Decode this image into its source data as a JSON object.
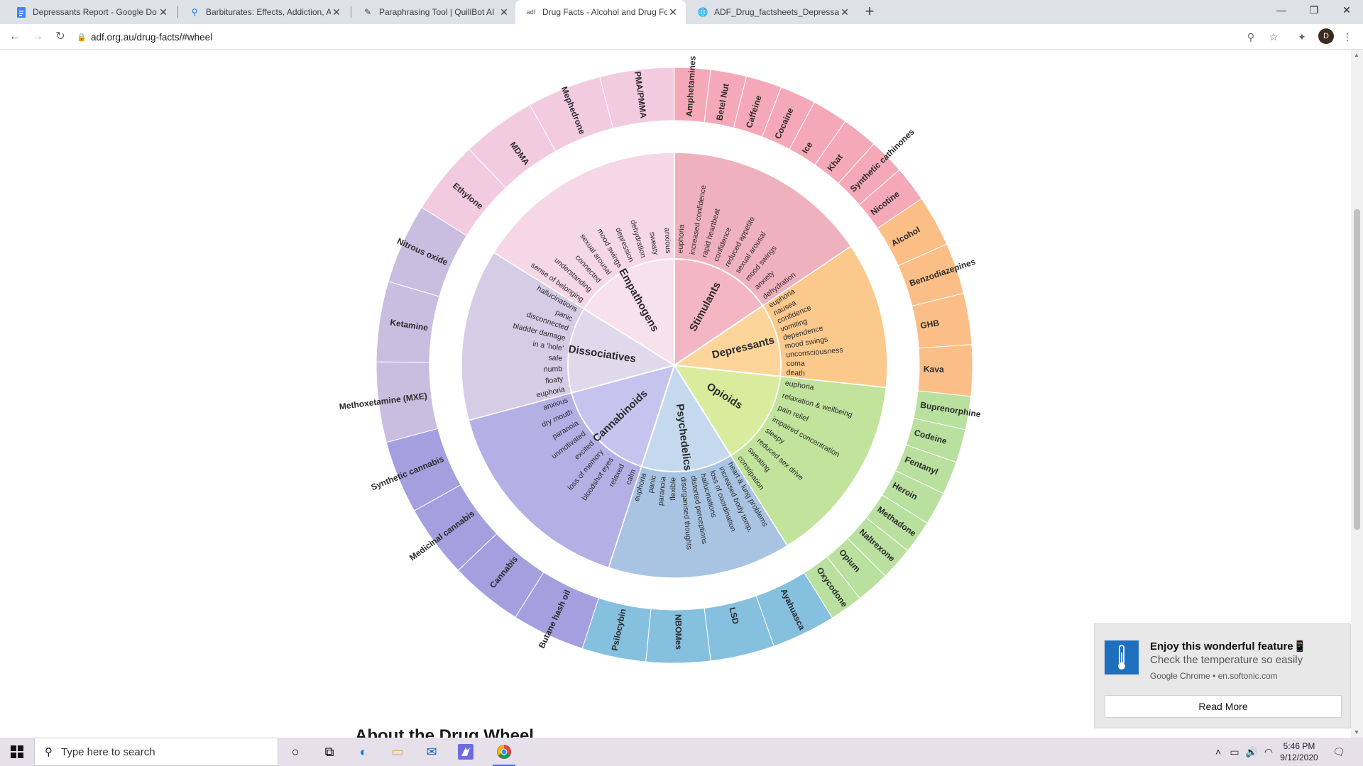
{
  "browser": {
    "tabs": [
      {
        "title": "Depressants Report - Google Do",
        "icon": "docs-icon",
        "color": "#4285f4"
      },
      {
        "title": "Barbiturates: Effects, Addiction, A",
        "icon": "pin-icon",
        "color": "#1a73e8"
      },
      {
        "title": "Paraphrasing Tool | QuillBot AI",
        "icon": "quill-icon",
        "color": "#5f6368"
      },
      {
        "title": "Drug Facts - Alcohol and Drug Fo",
        "icon": "adf-icon",
        "color": "#5f6368"
      },
      {
        "title": "ADF_Drug_factsheets_Depressants",
        "icon": "globe-icon",
        "color": "#5f6368"
      }
    ],
    "url": "adf.org.au/drug-facts/#wheel",
    "profile_initial": "D"
  },
  "wheel": {
    "categories": [
      {
        "name": "Stimulants",
        "color": "#f4b6c2",
        "mid": "#f0b1bf",
        "outer": "#f5a9b8",
        "effects": [
          "euphoria",
          "increased confidence",
          "rapid heartbeat",
          "confidence",
          "reduced appetite",
          "sexual arousal",
          "mood swings",
          "anxiety",
          "dehydration"
        ],
        "drugs": [
          "Amphetamines",
          "Betel Nut",
          "Caffeine",
          "Cocaine",
          "Ice",
          "Khat",
          "Synthetic cathinones",
          "Nicotine"
        ]
      },
      {
        "name": "Depressants",
        "color": "#fdd59b",
        "mid": "#fcc98c",
        "outer": "#fbbe86",
        "effects": [
          "euphoria",
          "nausea",
          "confidence",
          "vomiting",
          "dependence",
          "mood swings",
          "unconsciousness",
          "coma",
          "death"
        ],
        "drugs": [
          "Alcohol",
          "Benzodiazepines",
          "GHB",
          "Kava"
        ]
      },
      {
        "name": "Opioids",
        "color": "#d9ec9e",
        "mid": "#c2e39c",
        "outer": "#b9e09f",
        "effects": [
          "euphoria",
          "relaxation & wellbeing",
          "pain relief",
          "impaired concentration",
          "sleepy",
          "reduced sex drive",
          "sweating",
          "constipation"
        ],
        "drugs": [
          "Buprenorphine",
          "Codeine",
          "Fentanyl",
          "Heroin",
          "Methadone",
          "Naltrexone",
          "Opium",
          "Oxycodone"
        ]
      },
      {
        "name": "Psychedelics",
        "color": "#c5d9ee",
        "mid": "#a9c4e3",
        "outer": "#86c0df",
        "effects": [
          "heart & lung problems",
          "increased body temp.",
          "loss of coordination",
          "hallucinations",
          "distorted perceptions",
          "disorganised thoughts",
          "flexible",
          "paranoia",
          "panic",
          "euphoria"
        ],
        "drugs": [
          "Ayahuasca",
          "LSD",
          "NBOMes",
          "Psilocybin"
        ]
      },
      {
        "name": "Cannabinoids",
        "color": "#c6c3ef",
        "mid": "#b4b0e6",
        "outer": "#a49fde",
        "effects": [
          "calm",
          "relaxed",
          "bloodshot eyes",
          "loss of memory",
          "excited",
          "unmotivated",
          "paranoia",
          "dry mouth",
          "anxious"
        ],
        "drugs": [
          "Butane hash oil",
          "Cannabis",
          "Medicinal cannabis",
          "Synthetic cannabis"
        ]
      },
      {
        "name": "Dissociatives",
        "color": "#e0d9ec",
        "mid": "#d5cce6",
        "outer": "#c9bedf",
        "effects": [
          "euphoria",
          "floaty",
          "numb",
          "safe",
          "in a 'hole'",
          "bladder damage",
          "disconnected",
          "panic",
          "hallucinations"
        ],
        "drugs": [
          "Methoxetamine (MXE)",
          "Ketamine",
          "Nitrous oxide"
        ]
      },
      {
        "name": "Empathogens",
        "color": "#f7e1ec",
        "mid": "#f5d7e6",
        "outer": "#f3cbe0",
        "effects": [
          "sense of belonging",
          "understanding",
          "connected",
          "sexual arousal",
          "mood swings",
          "depression",
          "dehydration",
          "sweaty",
          "anxious"
        ],
        "drugs": [
          "Ethylone",
          "MDMA",
          "Mephedrone",
          "PMA/PMMA"
        ]
      }
    ]
  },
  "page": {
    "next_heading": "About the Drug Wheel"
  },
  "notification": {
    "title": "Enjoy this wonderful feature📱",
    "body": "Check the temperature so easily",
    "source": "Google Chrome • en.softonic.com",
    "button": "Read More"
  },
  "taskbar": {
    "search_placeholder": "Type here to search",
    "time": "5:46 PM",
    "date": "9/12/2020"
  }
}
